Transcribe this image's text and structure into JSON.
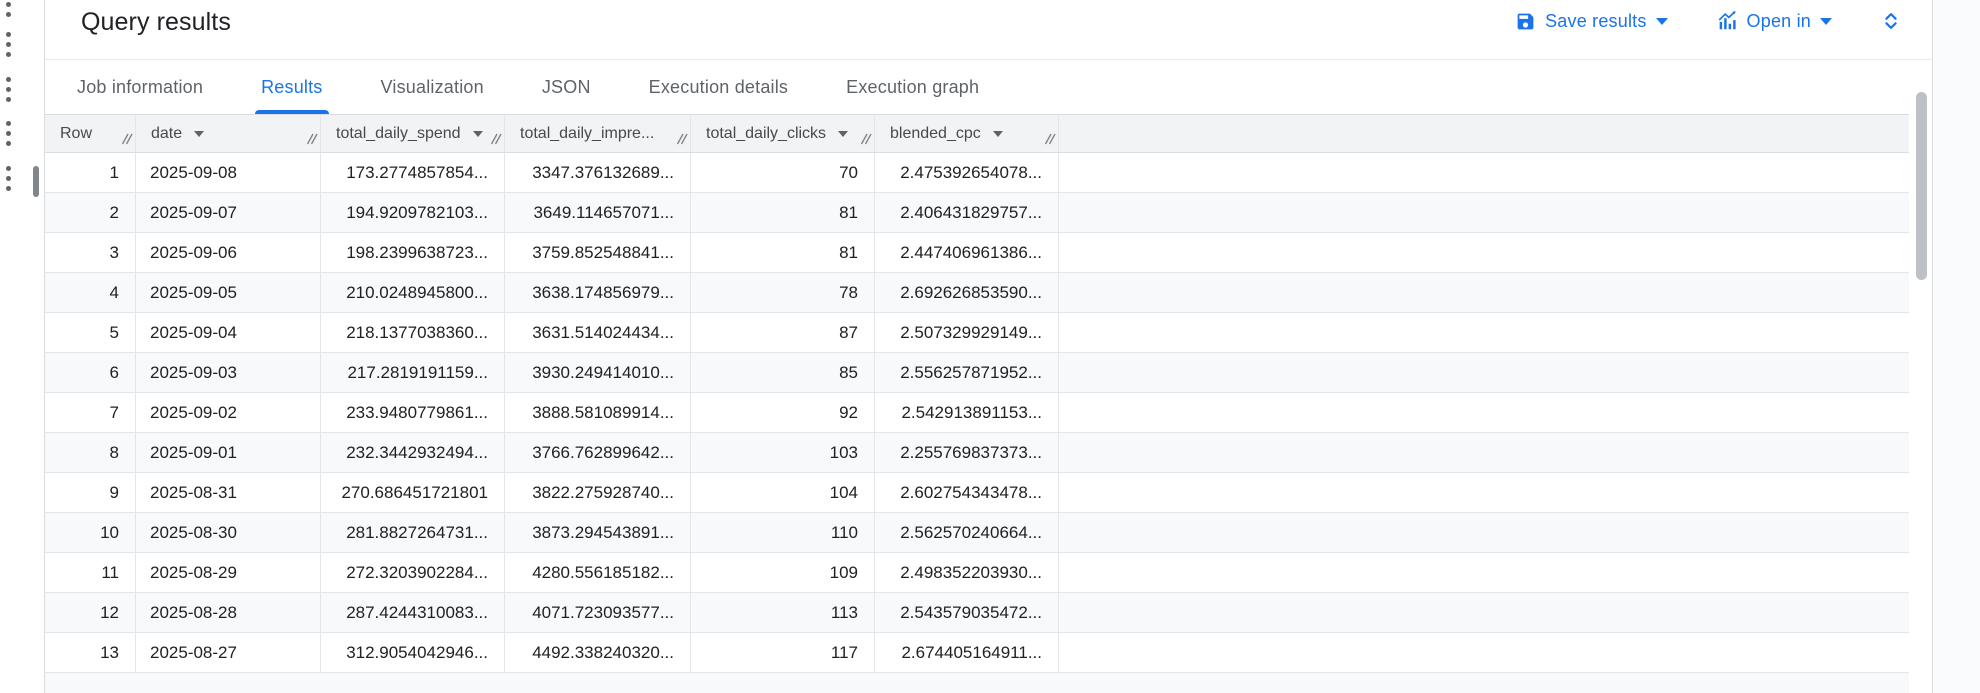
{
  "header": {
    "title": "Query results",
    "actions": {
      "save_results": "Save results",
      "open_in": "Open in"
    }
  },
  "tabs": [
    {
      "label": "Job information",
      "active": false
    },
    {
      "label": "Results",
      "active": true
    },
    {
      "label": "Visualization",
      "active": false
    },
    {
      "label": "JSON",
      "active": false
    },
    {
      "label": "Execution details",
      "active": false
    },
    {
      "label": "Execution graph",
      "active": false
    }
  ],
  "table": {
    "columns": [
      {
        "label": "Row",
        "sortable": false,
        "align": "right"
      },
      {
        "label": "date",
        "sortable": true,
        "align": "left"
      },
      {
        "label": "total_daily_spend",
        "sortable": true,
        "align": "right"
      },
      {
        "label": "total_daily_impre...",
        "sortable": false,
        "align": "right"
      },
      {
        "label": "total_daily_clicks",
        "sortable": true,
        "align": "right"
      },
      {
        "label": "blended_cpc",
        "sortable": true,
        "align": "right"
      }
    ],
    "rows": [
      [
        "1",
        "2025-09-08",
        "173.2774857854...",
        "3347.376132689...",
        "70",
        "2.475392654078..."
      ],
      [
        "2",
        "2025-09-07",
        "194.9209782103...",
        "3649.114657071...",
        "81",
        "2.406431829757..."
      ],
      [
        "3",
        "2025-09-06",
        "198.2399638723...",
        "3759.852548841...",
        "81",
        "2.447406961386..."
      ],
      [
        "4",
        "2025-09-05",
        "210.0248945800...",
        "3638.174856979...",
        "78",
        "2.692626853590..."
      ],
      [
        "5",
        "2025-09-04",
        "218.1377038360...",
        "3631.514024434...",
        "87",
        "2.507329929149..."
      ],
      [
        "6",
        "2025-09-03",
        "217.2819191159...",
        "3930.249414010...",
        "85",
        "2.556257871952..."
      ],
      [
        "7",
        "2025-09-02",
        "233.9480779861...",
        "3888.581089914...",
        "92",
        "2.542913891153..."
      ],
      [
        "8",
        "2025-09-01",
        "232.3442932494...",
        "3766.762899642...",
        "103",
        "2.255769837373..."
      ],
      [
        "9",
        "2025-08-31",
        "270.686451721801",
        "3822.275928740...",
        "104",
        "2.602754343478..."
      ],
      [
        "10",
        "2025-08-30",
        "281.8827264731...",
        "3873.294543891...",
        "110",
        "2.562570240664..."
      ],
      [
        "11",
        "2025-08-29",
        "272.3203902284...",
        "4280.556185182...",
        "109",
        "2.498352203930..."
      ],
      [
        "12",
        "2025-08-28",
        "287.4244310083...",
        "4071.723093577...",
        "113",
        "2.543579035472..."
      ],
      [
        "13",
        "2025-08-27",
        "312.9054042946...",
        "4492.338240320...",
        "117",
        "2.674405164911..."
      ]
    ]
  },
  "colors": {
    "accent": "#1a73e8",
    "text": "#202124",
    "muted": "#5f6368",
    "border": "#e3e5e8",
    "header_bg": "#f1f3f4",
    "stripe": "#f8f9fa",
    "panel_border": "#dadce0",
    "thumb": "#bdc1c6"
  }
}
